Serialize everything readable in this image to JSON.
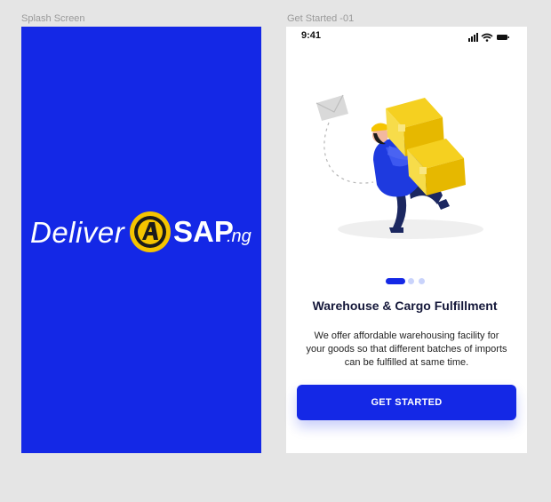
{
  "canvas": {
    "frames": [
      {
        "label": "Splash Screen"
      },
      {
        "label": "Get Started -01"
      }
    ]
  },
  "splash": {
    "logo": {
      "word": "Deliver",
      "badge_letter": "A",
      "word2": "SAP",
      "suffix": ".ng"
    },
    "colors": {
      "background": "#1428e6",
      "badge": "#f5c400"
    }
  },
  "get_started": {
    "status_bar": {
      "time": "9:41"
    },
    "pagination": {
      "total": 3,
      "active": 1
    },
    "title": "Warehouse & Cargo Fulfillment",
    "description": "We offer affordable warehousing facility for your goods so that different batches of imports can be fulfilled at same time.",
    "cta_label": "GET STARTED",
    "colors": {
      "primary": "#1428e6",
      "underline": "#35b6e8",
      "box": "#f5d020"
    }
  }
}
